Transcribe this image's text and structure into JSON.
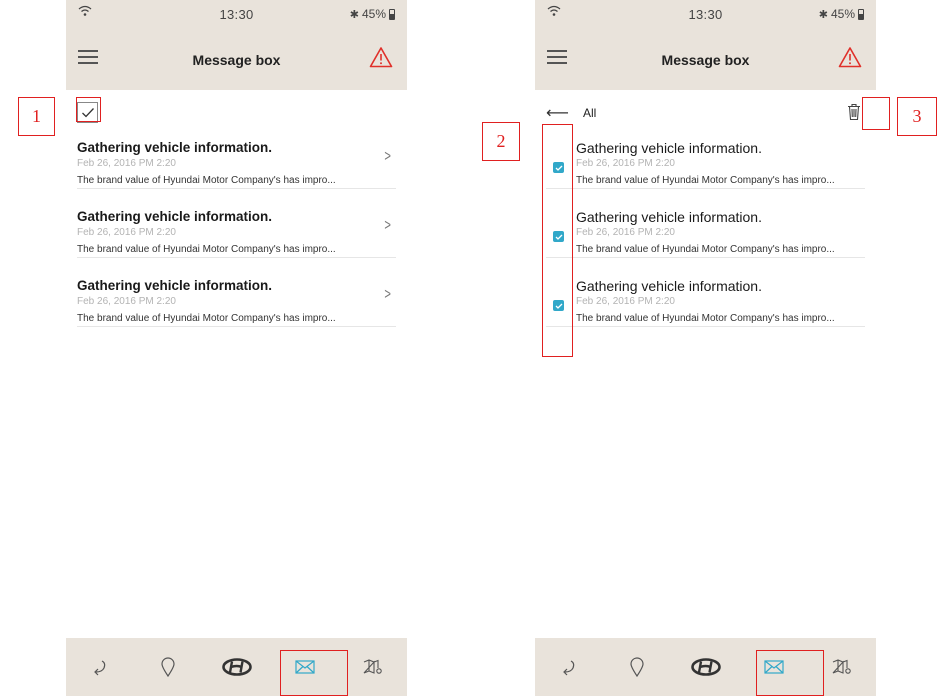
{
  "status": {
    "time": "13:30",
    "battery": "45%"
  },
  "header": {
    "title": "Message box"
  },
  "toolbar": {
    "all_label": "All"
  },
  "messages": [
    {
      "title": "Gathering vehicle information.",
      "date": "Feb 26, 2016 PM 2:20",
      "preview": "The brand value of Hyundai Motor Company's has impro...",
      "checked": true
    },
    {
      "title": "Gathering vehicle information.",
      "date": "Feb 26, 2016 PM 2:20",
      "preview": "The brand value of Hyundai Motor Company's has impro...",
      "checked": true
    },
    {
      "title": "Gathering vehicle information.",
      "date": "Feb 26, 2016 PM 2:20",
      "preview": "The brand value of Hyundai Motor Company's has impro...",
      "checked": true
    }
  ],
  "tabs": [
    {
      "icon": "return-icon"
    },
    {
      "icon": "location-pin-icon"
    },
    {
      "icon": "hyundai-logo-icon"
    },
    {
      "icon": "mail-icon",
      "selected": true
    },
    {
      "icon": "map-icon"
    }
  ],
  "annotations": {
    "label_1": "1",
    "label_2": "2",
    "label_3": "3"
  },
  "colors": {
    "header_bg": "#e9e3db",
    "accent_checkbox": "#31a8c9",
    "annotation_red": "#e02020",
    "alert_red": "#e0302a"
  }
}
